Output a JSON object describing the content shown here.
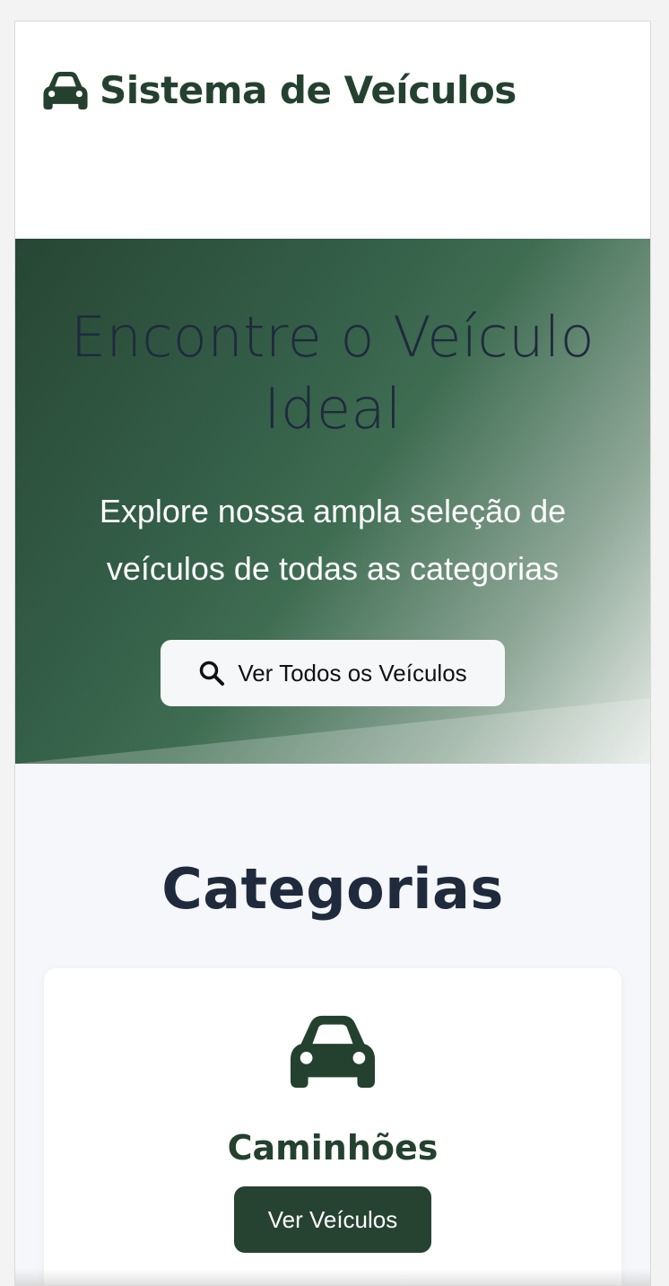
{
  "header": {
    "brand_icon": "car-icon",
    "title": "Sistema de Veículos"
  },
  "hero": {
    "title": "Encontre o Veículo Ideal",
    "subtitle": "Explore nossa ampla seleção de veículos de todas as categorias",
    "button_icon": "search-icon",
    "button_label": "Ver Todos os Veículos"
  },
  "categories": {
    "title": "Categorias",
    "items": [
      {
        "icon": "car-icon",
        "name": "Caminhões",
        "button_label": "Ver Veículos"
      }
    ]
  },
  "colors": {
    "brand": "#24412f",
    "button_dark": "#264230",
    "text_dark": "#1f2a3d",
    "page_bg": "#f5f7fa"
  }
}
